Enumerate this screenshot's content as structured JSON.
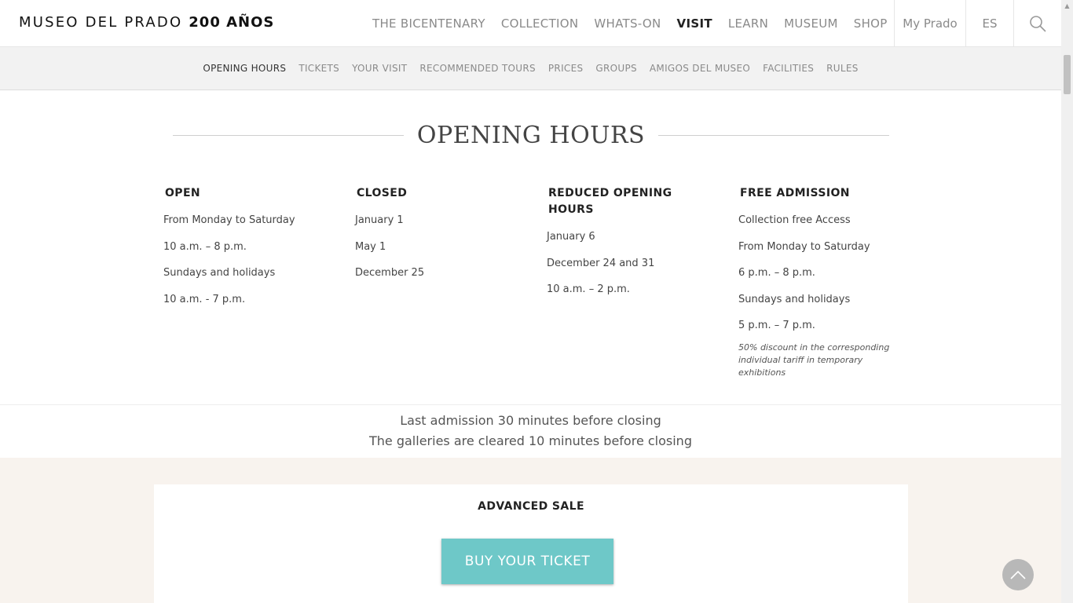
{
  "logo": {
    "name": "MUSEO DEL PRADO",
    "tagline": "200 AÑOS"
  },
  "main_nav": [
    {
      "label": "THE BICENTENARY",
      "active": false
    },
    {
      "label": "COLLECTION",
      "active": false
    },
    {
      "label": "WHATS-ON",
      "active": false
    },
    {
      "label": "VISIT",
      "active": true
    },
    {
      "label": "LEARN",
      "active": false
    },
    {
      "label": "MUSEUM",
      "active": false
    },
    {
      "label": "SHOP",
      "active": false
    }
  ],
  "header_right": {
    "my_prado": "My Prado",
    "language": "ES",
    "search_icon": "search-icon"
  },
  "sub_nav": [
    {
      "label": "OPENING HOURS",
      "active": true
    },
    {
      "label": "TICKETS",
      "active": false
    },
    {
      "label": "YOUR VISIT",
      "active": false
    },
    {
      "label": "RECOMMENDED TOURS",
      "active": false
    },
    {
      "label": "PRICES",
      "active": false
    },
    {
      "label": "GROUPS",
      "active": false
    },
    {
      "label": "AMIGOS DEL MUSEO",
      "active": false
    },
    {
      "label": "FACILITIES",
      "active": false
    },
    {
      "label": "RULES",
      "active": false
    }
  ],
  "page_title": "OPENING HOURS",
  "columns": {
    "open": {
      "heading": "OPEN",
      "lines": [
        "From Monday to Saturday",
        "10 a.m. – 8 p.m.",
        "Sundays and holidays",
        "10 a.m. - 7 p.m."
      ]
    },
    "closed": {
      "heading": "CLOSED",
      "lines": [
        "January 1",
        "May 1",
        "December 25"
      ]
    },
    "reduced": {
      "heading": "REDUCED OPENING HOURS",
      "lines": [
        "January 6",
        "December 24 and 31",
        "10 a.m. – 2 p.m."
      ]
    },
    "free": {
      "heading": "FREE ADMISSION",
      "lines": [
        "Collection free Access",
        "From Monday to Saturday",
        "6 p.m. – 8 p.m.",
        "Sundays and holidays",
        "5 p.m. – 7 p.m."
      ],
      "note": "50% discount in the corresponding individual tariff in temporary exhibitions"
    }
  },
  "closing_notes": {
    "line1": "Last admission 30 minutes before closing",
    "line2": "The galleries are cleared 10 minutes before closing"
  },
  "advanced_sale": {
    "title": "ADVANCED SALE",
    "button": "BUY YOUR TICKET"
  },
  "colors": {
    "accent": "#6ec8c8",
    "sale_band": "#f8f3ee",
    "subnav_bg": "#f2f2f2"
  },
  "icons": {
    "back_to_top": "chevron-up-icon"
  }
}
